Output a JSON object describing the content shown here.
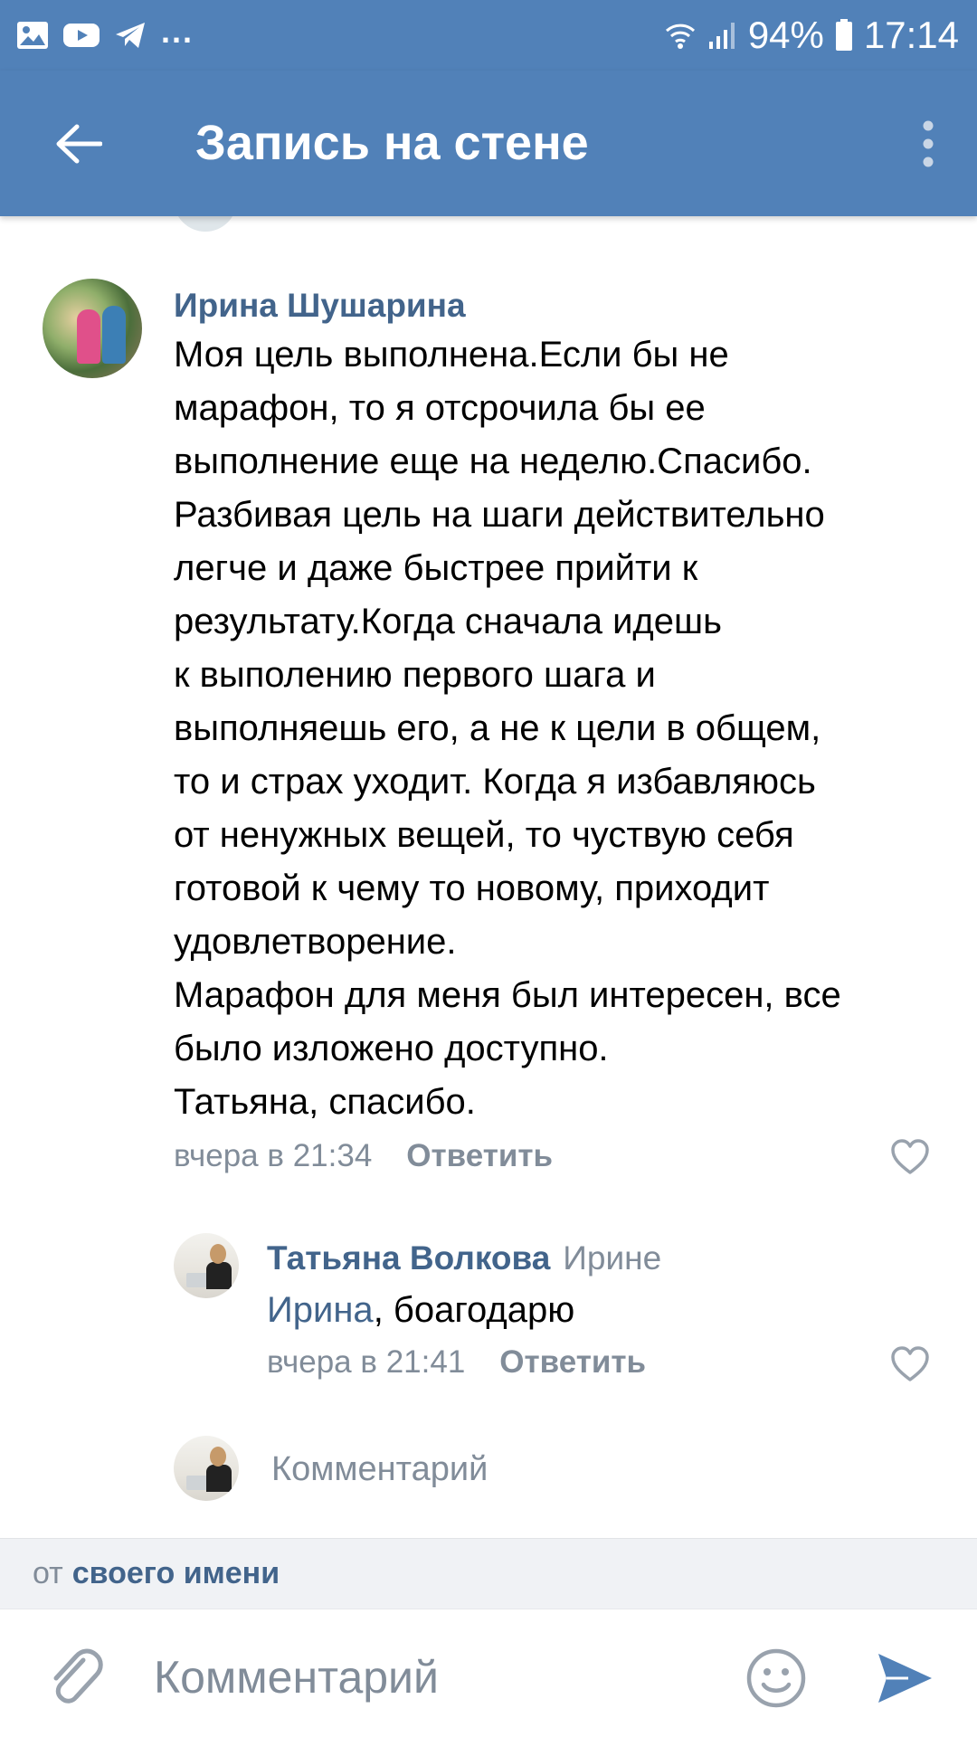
{
  "status_bar": {
    "icons": [
      "gallery-icon",
      "youtube-icon",
      "telegram-icon"
    ],
    "more": "...",
    "battery": "94%",
    "time": "17:14"
  },
  "app_bar": {
    "title": "Запись на стене",
    "back_icon": "arrow-left-icon",
    "more_icon": "more-vertical-icon"
  },
  "comments": [
    {
      "author": "Ирина Шушарина",
      "text": "Моя цель выполнена.Если бы не\nмарафон, то я отсрочила бы ее\nвыполнение еще на неделю.Спасибо.\nРазбивая цель на шаги действительно\nлегче и даже быстрее прийти к\nрезультату.Когда сначала идешь\nк выполению первого шага и\nвыполняешь его, а не к цели в общем,\nто и страх уходит. Когда я избавляюсь\nот ненужных вещей, то чуствую себя\nготовой к чему то новому, приходит\nудовлетворение.\nМарафон для меня был интересен, все\nбыло изложено доступно.\nТатьяна, спасибо.",
      "time": "вчера в 21:34",
      "reply_label": "Ответить"
    },
    {
      "author": "Татьяна Волкова",
      "reply_to": "Ирине",
      "mention": "Ирина",
      "text": ", боагодарю",
      "time": "вчера в 21:41",
      "reply_label": "Ответить"
    }
  ],
  "compose_row": {
    "placeholder": "Комментарий"
  },
  "from_strip": {
    "prefix": "от",
    "link": "своего имени"
  },
  "composer": {
    "placeholder": "Комментарий"
  },
  "colors": {
    "brand": "#5181b8",
    "link": "#42648b",
    "secondary": "#818c99"
  }
}
